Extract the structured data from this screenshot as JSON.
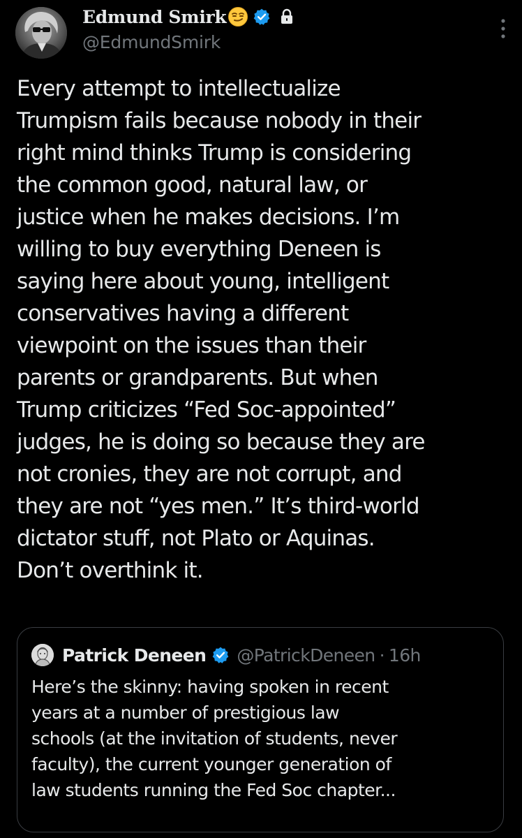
{
  "post": {
    "author": {
      "display_name": "Edmund Smirk",
      "handle": "@EdmundSmirk",
      "name_emoji": "smirking-face-emoji",
      "verified_color": "#1d9bf0",
      "protected": "lock-icon"
    },
    "more_icon": "more-vertical-icon",
    "text": "Every attempt to intellectualize\nTrumpism fails because nobody in their\nright mind thinks Trump is considering\nthe common good, natural law, or\njustice when he makes decisions. I’m\nwilling to buy everything Deneen is\nsaying here about young, intelligent\nconservatives having a different\nviewpoint on the issues than their\nparents or grandparents. But when\nTrump criticizes “Fed Soc-appointed”\njudges, he is doing so because they are\nnot cronies, they are not corrupt, and\nthey are not “yes men.” It’s third-world\ndictator stuff, not Plato or Aquinas.\nDon’t overthink it.",
    "quoted": {
      "display_name": "Patrick Deneen",
      "handle": "@PatrickDeneen",
      "separator": "·",
      "time": "16h",
      "text": "Here’s the skinny: having spoken in recent\nyears at a number of prestigious law\nschools (at the invitation of students, never\nfaculty), the current younger generation of\nlaw students running the Fed Soc chapter..."
    }
  },
  "colors": {
    "background": "#000000",
    "text_primary": "#e7e9ea",
    "text_secondary": "#71767b",
    "verified": "#1d9bf0",
    "border": "#3a3d42"
  }
}
